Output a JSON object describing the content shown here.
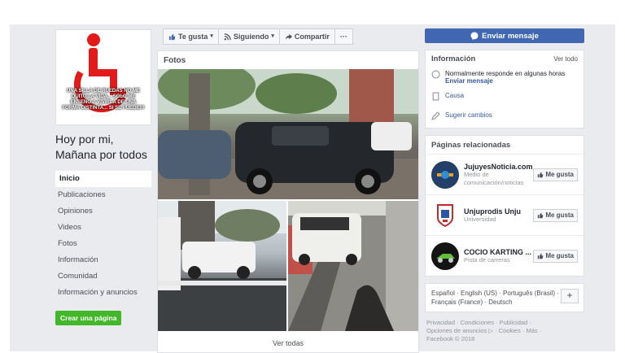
{
  "page": {
    "name_line1": "Hoy por mi,",
    "name_line2": "Mañana por todos",
    "avatar_text": "UNA SILLA DE RUEDAS NO ME QUITO LA VIDA... SOLO ME ENSEÑO A VIVIRLA DE UNA FORMA DISTINTA... SI SE PUEDE!!!"
  },
  "nav": [
    {
      "label": "Inicio"
    },
    {
      "label": "Publicaciones"
    },
    {
      "label": "Opiniones"
    },
    {
      "label": "Videos"
    },
    {
      "label": "Fotos"
    },
    {
      "label": "Información"
    },
    {
      "label": "Comunidad"
    },
    {
      "label": "Información y anuncios"
    }
  ],
  "create_page": "Crear una página",
  "actions": {
    "like": "Te gusta",
    "follow": "Siguiendo",
    "share": "Compartir",
    "more": "···"
  },
  "photos": {
    "title": "Fotos",
    "see_all": "Ver todas"
  },
  "message_button": "Enviar mensaje",
  "info": {
    "title": "Información",
    "see_all": "Ver todo",
    "response": "Normalmente responde en algunas horas",
    "send_message": "Enviar mensaje",
    "cause": "Causa",
    "suggest": "Sugerir cambios"
  },
  "related": {
    "title": "Páginas relacionadas",
    "like_label": "Me gusta",
    "items": [
      {
        "name": "JujuyesNoticia.com",
        "sub": "Medio de comunicación/noticias"
      },
      {
        "name": "Unjuprodis Unju",
        "sub": "Universidad"
      },
      {
        "name": "COCIO KARTING ...",
        "sub": "Pista de carreras"
      }
    ]
  },
  "languages": {
    "line1": "Español · English (US) · Português (Brasil) ·",
    "line2": "Français (France) · Deutsch",
    "plus": "+"
  },
  "footer": {
    "line1": "Privacidad · Condiciones · Publicidad ·",
    "line2": "Opciones de anuncios ▷ · Cookies · Más ·",
    "line3": "Facebook © 2018"
  },
  "colors": {
    "brand_blue": "#4267b2",
    "green": "#42b72a",
    "link": "#385898"
  }
}
